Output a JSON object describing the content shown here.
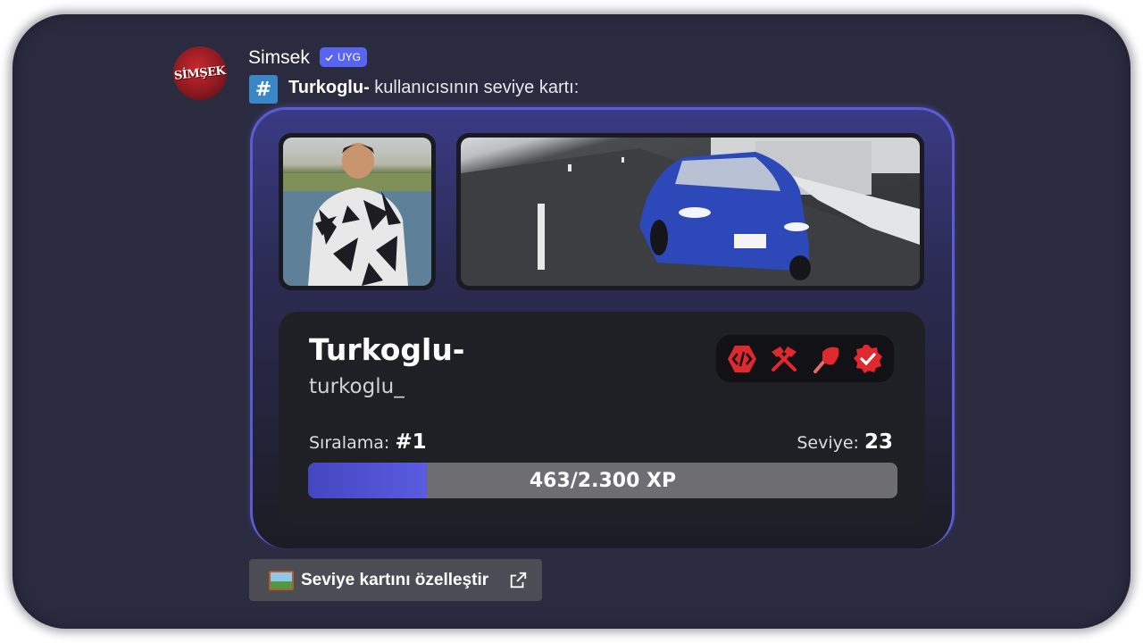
{
  "message": {
    "author": "Simsek",
    "author_avatar_text": "SİMŞEK",
    "app_badge": "UYG",
    "channel_icon": "#",
    "target_name": "Turkoglu-",
    "text": "kullanıcısının seviye kartı:"
  },
  "card": {
    "display_name": "Turkoglu-",
    "username": "turkoglu_",
    "rank_label": "Sıralama:",
    "rank_value": "#1",
    "level_label": "Seviye:",
    "level_value": "23",
    "xp_text": "463/2.300 XP",
    "xp_fraction": 0.2013,
    "badges": [
      "developer-badge-icon",
      "moderator-hammer-icon",
      "staff-pickaxe-icon",
      "verified-check-icon"
    ],
    "badge_color": "#e0282f",
    "accent": "#5b5bd6"
  },
  "actions": {
    "customize_label": "Seviye kartını özelleştir"
  }
}
